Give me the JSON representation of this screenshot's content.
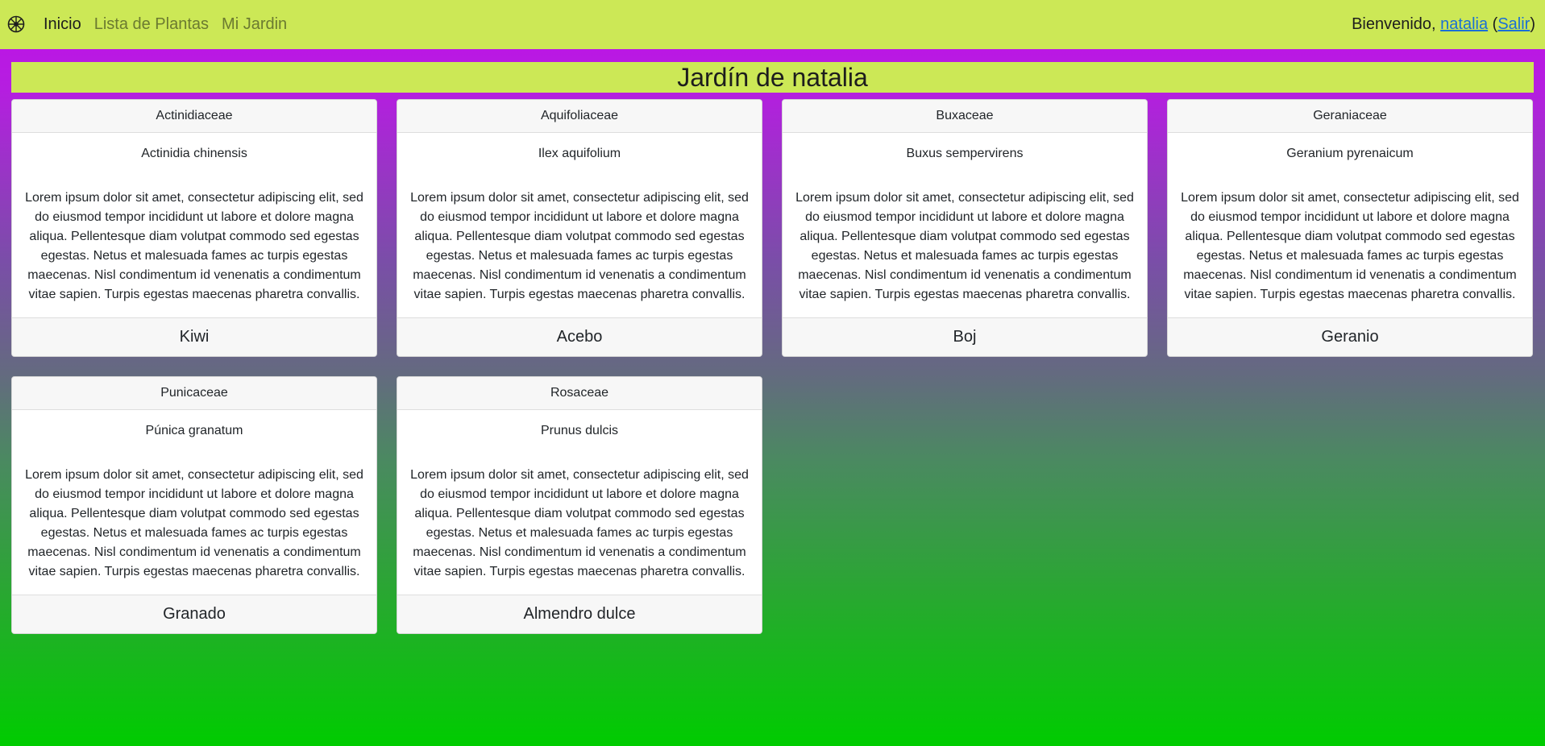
{
  "nav": {
    "links": [
      {
        "label": "Inicio",
        "active": true
      },
      {
        "label": "Lista de Plantas",
        "active": false
      },
      {
        "label": "Mi Jardin",
        "active": false
      }
    ],
    "welcome_text": "Bienvenido,",
    "username": "natalia",
    "logout_label": "Salir",
    "brand_icon": "flower-icon"
  },
  "page_title": "Jardín de natalia",
  "cards": [
    {
      "family": "Actinidiaceae",
      "scientific": "Actinidia chinensis",
      "description": "Lorem ipsum dolor sit amet, consectetur adipiscing elit, sed do eiusmod tempor incididunt ut labore et dolore magna aliqua. Pellentesque diam volutpat commodo sed egestas egestas. Netus et malesuada fames ac turpis egestas maecenas. Nisl condimentum id venenatis a condimentum vitae sapien. Turpis egestas maecenas pharetra convallis.",
      "common": "Kiwi"
    },
    {
      "family": "Aquifoliaceae",
      "scientific": "Ilex aquifolium",
      "description": "Lorem ipsum dolor sit amet, consectetur adipiscing elit, sed do eiusmod tempor incididunt ut labore et dolore magna aliqua. Pellentesque diam volutpat commodo sed egestas egestas. Netus et malesuada fames ac turpis egestas maecenas. Nisl condimentum id venenatis a condimentum vitae sapien. Turpis egestas maecenas pharetra convallis.",
      "common": "Acebo"
    },
    {
      "family": "Buxaceae",
      "scientific": "Buxus sempervirens",
      "description": "Lorem ipsum dolor sit amet, consectetur adipiscing elit, sed do eiusmod tempor incididunt ut labore et dolore magna aliqua. Pellentesque diam volutpat commodo sed egestas egestas. Netus et malesuada fames ac turpis egestas maecenas. Nisl condimentum id venenatis a condimentum vitae sapien. Turpis egestas maecenas pharetra convallis.",
      "common": "Boj"
    },
    {
      "family": "Geraniaceae",
      "scientific": "Geranium pyrenaicum",
      "description": "Lorem ipsum dolor sit amet, consectetur adipiscing elit, sed do eiusmod tempor incididunt ut labore et dolore magna aliqua. Pellentesque diam volutpat commodo sed egestas egestas. Netus et malesuada fames ac turpis egestas maecenas. Nisl condimentum id venenatis a condimentum vitae sapien. Turpis egestas maecenas pharetra convallis.",
      "common": "Geranio"
    },
    {
      "family": "Punicaceae",
      "scientific": "Púnica granatum",
      "description": "Lorem ipsum dolor sit amet, consectetur adipiscing elit, sed do eiusmod tempor incididunt ut labore et dolore magna aliqua. Pellentesque diam volutpat commodo sed egestas egestas. Netus et malesuada fames ac turpis egestas maecenas. Nisl condimentum id venenatis a condimentum vitae sapien. Turpis egestas maecenas pharetra convallis.",
      "common": "Granado"
    },
    {
      "family": "Rosaceae",
      "scientific": "Prunus dulcis",
      "description": "Lorem ipsum dolor sit amet, consectetur adipiscing elit, sed do eiusmod tempor incididunt ut labore et dolore magna aliqua. Pellentesque diam volutpat commodo sed egestas egestas. Netus et malesuada fames ac turpis egestas maecenas. Nisl condimentum id venenatis a condimentum vitae sapien. Turpis egestas maecenas pharetra convallis.",
      "common": "Almendro dulce"
    }
  ],
  "colors": {
    "accent": "#cce856",
    "gradient_top": "#c010e8",
    "gradient_bottom": "#00cc00",
    "link": "#1a6fd6"
  }
}
